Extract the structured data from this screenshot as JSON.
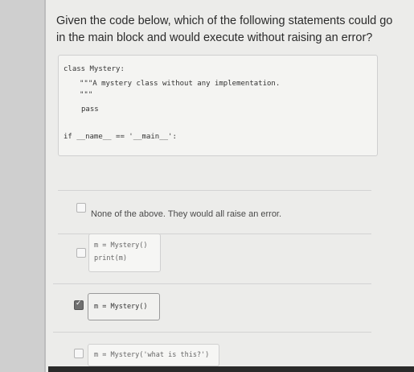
{
  "question": {
    "text": "Given the code below, which of the following statements could go in the main block and would execute without raising an error?"
  },
  "code": {
    "lines": [
      "class Mystery:",
      "\"\"\"A mystery class without any implementation.",
      "\"\"\"",
      "pass",
      "if __name__ == '__main__':"
    ]
  },
  "options": [
    {
      "text": "None of the above. They would all raise an error.",
      "checked": false
    },
    {
      "lines": [
        "m = Mystery()",
        "print(m)"
      ],
      "checked": false
    },
    {
      "lines": [
        "m = Mystery()"
      ],
      "checked": true
    },
    {
      "lines": [
        "m = Mystery('what is this?')"
      ],
      "checked": false
    }
  ]
}
